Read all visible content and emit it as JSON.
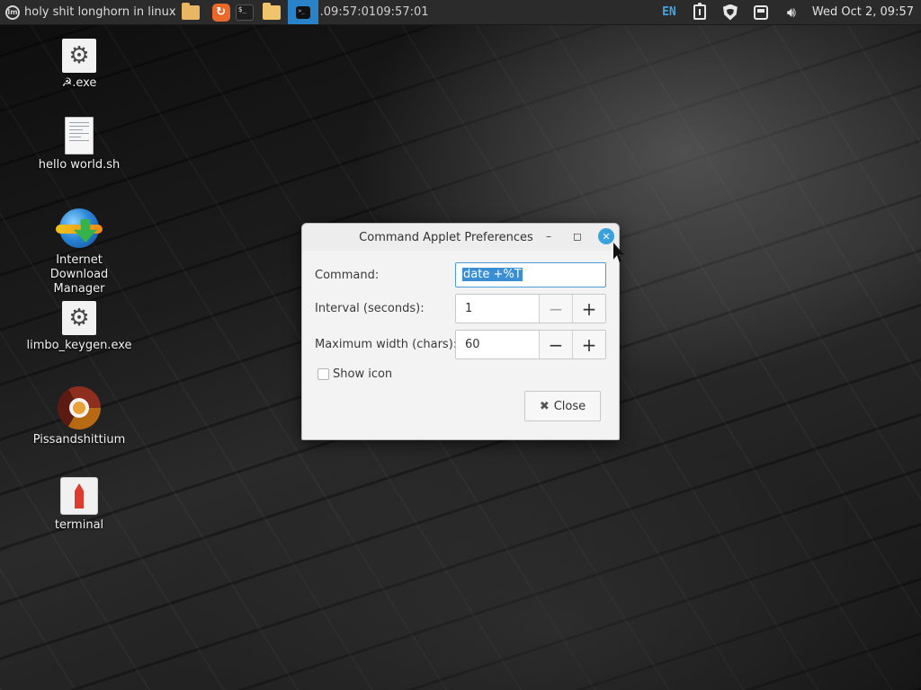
{
  "panel": {
    "menu_label": "holy shit longhorn in linux",
    "command_output": ".09:57:0109:57:01",
    "language": "EN",
    "clock": "Wed Oct  2, 09:57",
    "launchers": [
      "folder-icon",
      "update-manager-icon",
      "terminal-icon",
      "files-icon"
    ],
    "accent_color": "#2a83c8"
  },
  "desktop": {
    "icons": [
      {
        "label": "☭.exe",
        "icon": "gear-icon"
      },
      {
        "label": "hello world.sh",
        "icon": "text-file-icon"
      },
      {
        "label": "Internet Download Manager",
        "icon": "idm-icon"
      },
      {
        "label": "limbo_keygen.exe",
        "icon": "gear-icon"
      },
      {
        "label": "Pissandshittium",
        "icon": "chrome-icon"
      },
      {
        "label": "terminal",
        "icon": "rocket-icon"
      }
    ]
  },
  "dialog": {
    "title": "Command Applet Preferences",
    "command_label": "Command:",
    "command_value": "date +%T",
    "interval_label": "Interval (seconds):",
    "interval_value": "1",
    "width_label": "Maximum width (chars):",
    "width_value": "60",
    "show_icon_label": "Show icon",
    "show_icon_checked": false,
    "close_label": "Close"
  }
}
